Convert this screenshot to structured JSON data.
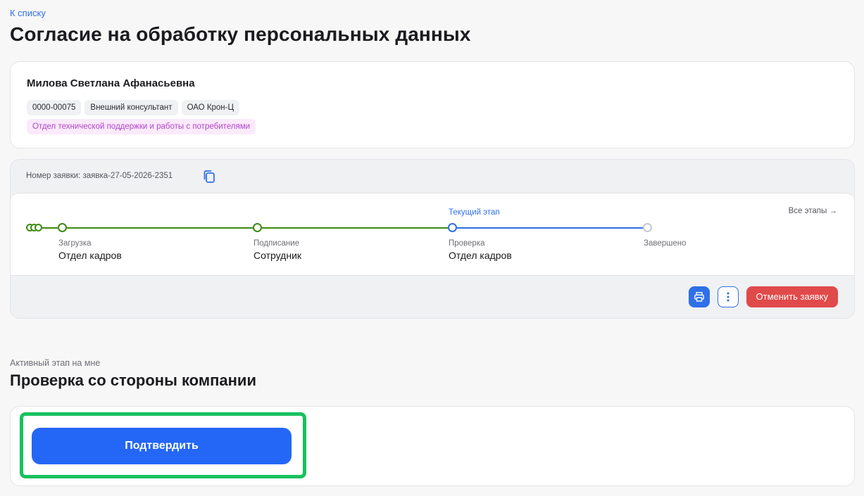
{
  "nav": {
    "back_label": "К списку"
  },
  "page": {
    "title": "Согласие на обработку персональных данных"
  },
  "person": {
    "name": "Милова Светлана Афанасьевна",
    "tags": [
      "0000-00075",
      "Внешний консультант",
      "ОАО Крон-Ц"
    ],
    "department": "Отдел технической поддержки и работы с потребителями"
  },
  "request": {
    "number_label": "Номер заявки: заявка-27-05-2026-2351",
    "current_stage_label": "Текущий этап",
    "all_stages_label": "Все этапы →",
    "stages": [
      {
        "name": "Загрузка",
        "owner": "Отдел кадров",
        "status": "done"
      },
      {
        "name": "Подписание",
        "owner": "Сотрудник",
        "status": "done"
      },
      {
        "name": "Проверка",
        "owner": "Отдел кадров",
        "status": "current"
      },
      {
        "name": "Завершено",
        "owner": "",
        "status": "pending"
      }
    ],
    "cancel_label": "Отменить заявку"
  },
  "active_step": {
    "caption": "Активный этап на мне",
    "title": "Проверка со стороны компании",
    "confirm_label": "Подтвердить"
  },
  "icons": {
    "copy": "copy-icon",
    "print": "printer-icon",
    "more": "more-vertical-icon"
  },
  "colors": {
    "accent": "#2f6fe8",
    "done": "#3d8a12",
    "danger": "#e14a4a",
    "highlight": "#17c15f",
    "department_text": "#b144c9"
  }
}
